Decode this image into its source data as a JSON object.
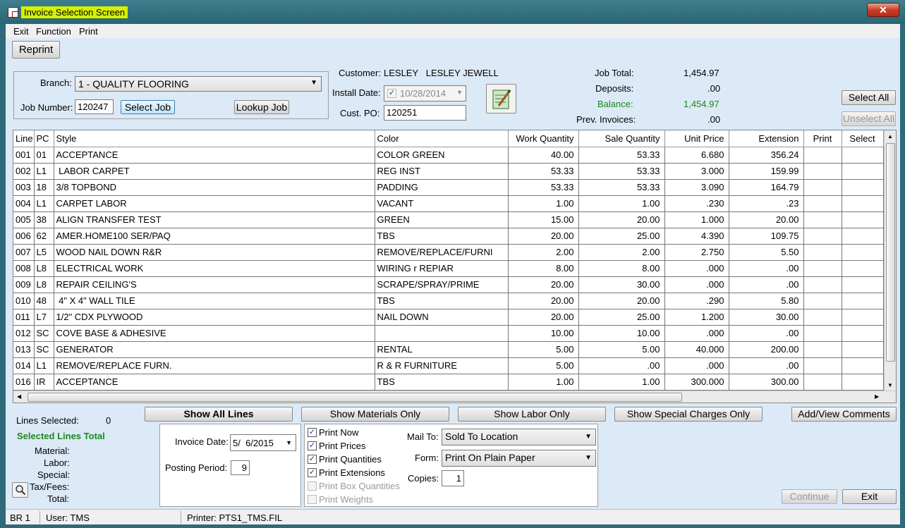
{
  "window": {
    "title": "Invoice Selection Screen",
    "close_glyph": "✕"
  },
  "menu": {
    "items": [
      "Exit",
      "Function",
      "Print"
    ]
  },
  "toolbar": {
    "reprint_label": "Reprint"
  },
  "job": {
    "branch_label": "Branch:",
    "branch_value": "1  - QUALITY FLOORING",
    "job_number_label": "Job Number:",
    "job_number_value": "120247",
    "select_job_label": "Select Job",
    "lookup_job_label": "Lookup Job"
  },
  "customer": {
    "customer_label": "Customer:",
    "customer_value": "LESLEY   LESLEY JEWELL",
    "install_date_label": "Install Date:",
    "install_date_value": "10/28/2014",
    "cust_po_label": "Cust. PO:",
    "cust_po_value": "120251",
    "notes_icon": "notepad-icon"
  },
  "totals": {
    "job_total_label": "Job Total:",
    "job_total_value": "1,454.97",
    "deposits_label": "Deposits:",
    "deposits_value": ".00",
    "balance_label": "Balance:",
    "balance_value": "1,454.97",
    "prev_invoices_label": "Prev. Invoices:",
    "prev_invoices_value": ".00",
    "balance_color": "#1a8a1a"
  },
  "selection": {
    "select_all_label": "Select All",
    "unselect_all_label": "Unselect All"
  },
  "grid": {
    "columns": [
      "Line",
      "PC",
      "Style",
      "Color",
      "Work Quantity",
      "Sale Quantity",
      "Unit Price",
      "Extension",
      "Print",
      "Select"
    ],
    "rows": [
      [
        "001",
        "01",
        "ACCEPTANCE",
        "COLOR GREEN",
        "40.00",
        "53.33",
        "6.680",
        "356.24"
      ],
      [
        "002",
        "L1",
        " LABOR CARPET",
        "REG INST",
        "53.33",
        "53.33",
        "3.000",
        "159.99"
      ],
      [
        "003",
        "18",
        "3/8 TOPBOND",
        "PADDING",
        "53.33",
        "53.33",
        "3.090",
        "164.79"
      ],
      [
        "004",
        "L1",
        "CARPET LABOR",
        "VACANT",
        "1.00",
        "1.00",
        ".230",
        ".23"
      ],
      [
        "005",
        "38",
        "ALIGN TRANSFER TEST",
        "GREEN",
        "15.00",
        "20.00",
        "1.000",
        "20.00"
      ],
      [
        "006",
        "62",
        "AMER.HOME100 SER/PAQ",
        "TBS",
        "20.00",
        "25.00",
        "4.390",
        "109.75"
      ],
      [
        "007",
        "L5",
        "WOOD NAIL DOWN R&R",
        "REMOVE/REPLACE/FURNI",
        "2.00",
        "2.00",
        "2.750",
        "5.50"
      ],
      [
        "008",
        "L8",
        "ELECTRICAL WORK",
        "WIRING r REPIAR",
        "8.00",
        "8.00",
        ".000",
        ".00"
      ],
      [
        "009",
        "L8",
        "REPAIR CEILING'S",
        "SCRAPE/SPRAY/PRIME",
        "20.00",
        "30.00",
        ".000",
        ".00"
      ],
      [
        "010",
        "48",
        " 4\" X 4\" WALL TILE",
        "TBS",
        "20.00",
        "20.00",
        ".290",
        "5.80"
      ],
      [
        "011",
        "L7",
        "1/2\" CDX PLYWOOD",
        "NAIL DOWN",
        "20.00",
        "25.00",
        "1.200",
        "30.00"
      ],
      [
        "012",
        "SC",
        "COVE BASE & ADHESIVE",
        "",
        "10.00",
        "10.00",
        ".000",
        ".00"
      ],
      [
        "013",
        "SC",
        "GENERATOR",
        "RENTAL",
        "5.00",
        "5.00",
        "40.000",
        "200.00"
      ],
      [
        "014",
        "L1",
        "REMOVE/REPLACE FURN.",
        "R & R FURNITURE",
        "5.00",
        ".00",
        ".000",
        ".00"
      ],
      [
        "016",
        "IR",
        "ACCEPTANCE",
        "TBS",
        "1.00",
        "1.00",
        "300.000",
        "300.00"
      ]
    ]
  },
  "filters": {
    "show_all": "Show All Lines",
    "show_materials": "Show Materials Only",
    "show_labor": "Show Labor Only",
    "show_special": "Show Special Charges Only",
    "add_comments": "Add/View Comments"
  },
  "summary": {
    "lines_selected_label": "Lines Selected:",
    "lines_selected_value": "0",
    "selected_total_label": "Selected Lines Total",
    "material_label": "Material:",
    "labor_label": "Labor:",
    "special_label": "Special:",
    "taxfees_label": "Tax/Fees:",
    "total_label": "Total:"
  },
  "invoice": {
    "invoice_date_label": "Invoice Date:",
    "invoice_date_value": "5/  6/2015",
    "posting_period_label": "Posting Period:",
    "posting_period_value": "9"
  },
  "print_options": {
    "print_now": "Print Now",
    "print_prices": "Print Prices",
    "print_quantities": "Print Quantities",
    "print_extensions": "Print Extensions",
    "print_box_quantities": "Print Box Quantities",
    "print_weights": "Print Weights",
    "mail_to_label": "Mail To:",
    "mail_to_value": "Sold To Location",
    "form_label": "Form:",
    "form_value": "Print On Plain Paper",
    "copies_label": "Copies:",
    "copies_value": "1"
  },
  "actions": {
    "continue_label": "Continue",
    "exit_label": "Exit"
  },
  "status": {
    "branch": "BR 1",
    "user": "User: TMS",
    "printer": "Printer: PTS1_TMS.FIL"
  }
}
